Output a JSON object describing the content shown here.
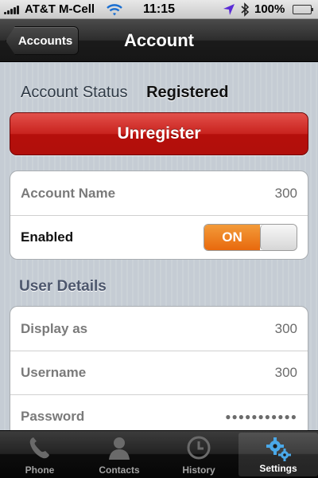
{
  "status_bar": {
    "carrier": "AT&T M-Cell",
    "time": "11:15",
    "battery_text": "100%",
    "battery_level": 1.0
  },
  "nav": {
    "back_label": "Accounts",
    "title": "Account"
  },
  "account_status": {
    "label": "Account Status",
    "value": "Registered"
  },
  "unregister_label": "Unregister",
  "account_group": {
    "name_label": "Account Name",
    "name_value": "300",
    "enabled_label": "Enabled",
    "enabled_toggle_label": "ON",
    "enabled": true
  },
  "user_details": {
    "header": "User Details",
    "display_as_label": "Display as",
    "display_as_value": "300",
    "username_label": "Username",
    "username_value": "300",
    "password_label": "Password",
    "password_value": "●●●●●●●●●●●"
  },
  "tabs": [
    {
      "label": "Phone",
      "icon": "phone-icon",
      "active": false
    },
    {
      "label": "Contacts",
      "icon": "contacts-icon",
      "active": false
    },
    {
      "label": "History",
      "icon": "clock-icon",
      "active": false
    },
    {
      "label": "Settings",
      "icon": "gears-icon",
      "active": true
    }
  ],
  "colors": {
    "unregister": "#c9231e",
    "toggle_on": "#e8690d",
    "battery": "#3eaa12",
    "active_tab_icon": "#4aa8e8"
  }
}
